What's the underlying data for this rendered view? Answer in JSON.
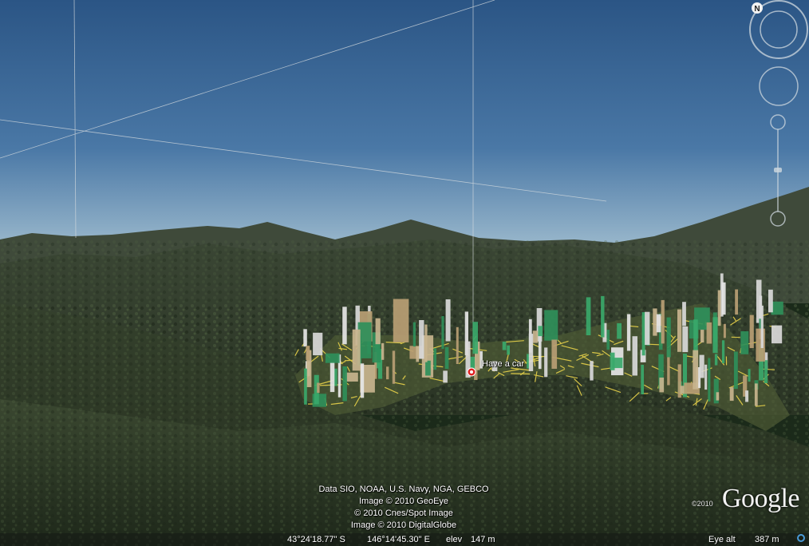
{
  "placemark": {
    "label": "Have a car",
    "icon": "red-placemark-icon",
    "color": "#e02020"
  },
  "attribution": [
    "Data SIO, NOAA, U.S. Navy, NGA, GEBCO",
    "Image © 2010 GeoEye",
    "© 2010 Cnes/Spot Image",
    "Image © 2010 DigitalGlobe"
  ],
  "logo": {
    "year": "©2010",
    "text": "Google"
  },
  "status_bar": {
    "latitude": "43°24'18.77\" S",
    "longitude": "146°14'45.30\" E",
    "elev_label": "elev",
    "elev_value": "147 m",
    "eye_alt_label": "Eye alt",
    "eye_alt_value": "387 m"
  },
  "navigation": {
    "compass_north": "N",
    "icons": [
      "compass-ring-icon",
      "look-joystick-icon",
      "zoom-slider-icon"
    ]
  },
  "colors": {
    "sky_top": "#2f5a8a",
    "sky_horizon": "#8fb0c8",
    "terrain": "#2e3a26",
    "roads": "#e8d24a",
    "buildings": "#3aa86a"
  }
}
